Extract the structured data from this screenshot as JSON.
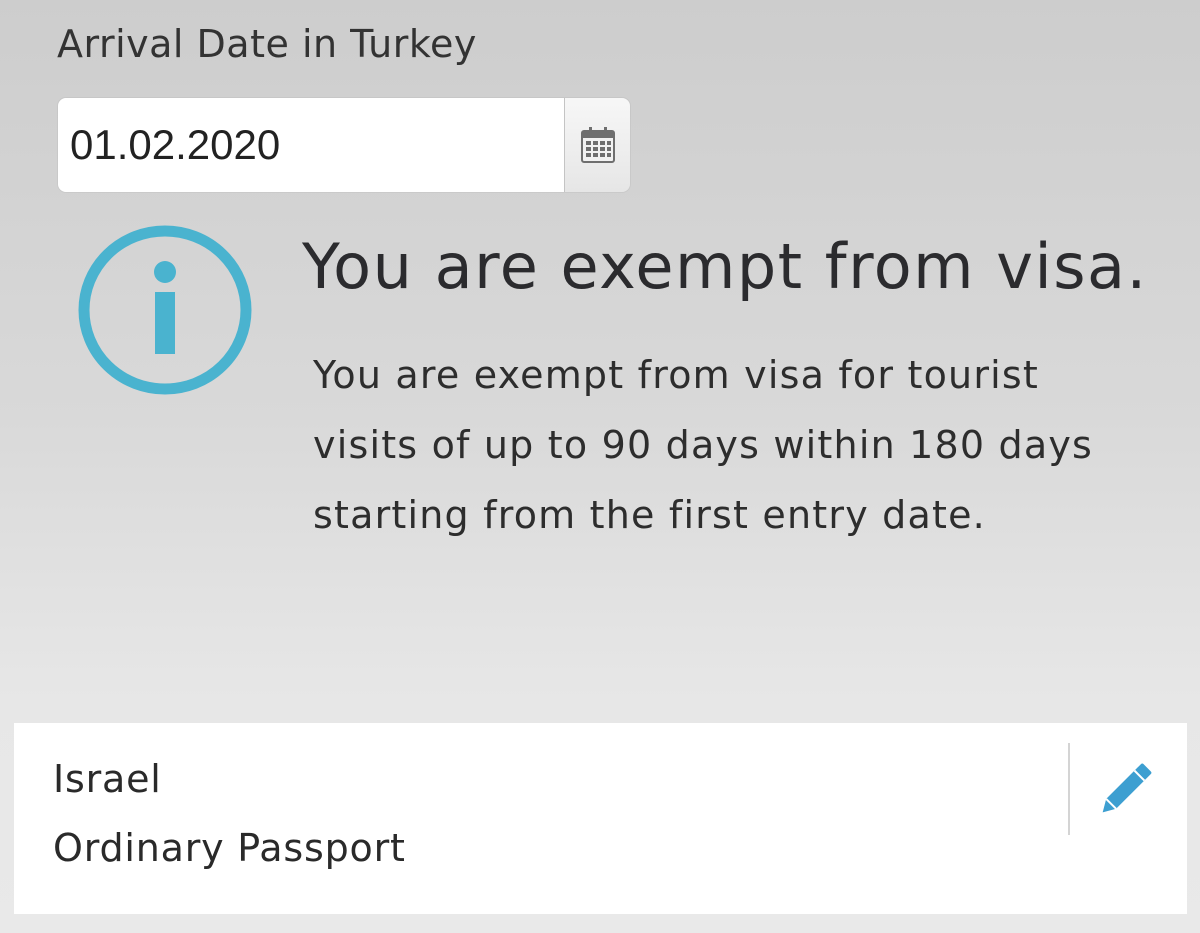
{
  "arrival": {
    "label": "Arrival Date in Turkey",
    "date_value": "01.02.2020"
  },
  "result": {
    "title": "You are exempt from visa.",
    "message": "You are exempt from visa for tourist visits of up to 90 days within 180 days starting from the first entry date."
  },
  "passport": {
    "country": "Israel",
    "type": "Ordinary Passport"
  },
  "icons": {
    "calendar": "calendar-icon",
    "info": "info-icon",
    "edit": "pencil-icon"
  },
  "colors": {
    "accent": "#4ab3cf",
    "edit_icon": "#3d9fd1",
    "text": "#2b2b2e",
    "card_background": "#ffffff"
  }
}
